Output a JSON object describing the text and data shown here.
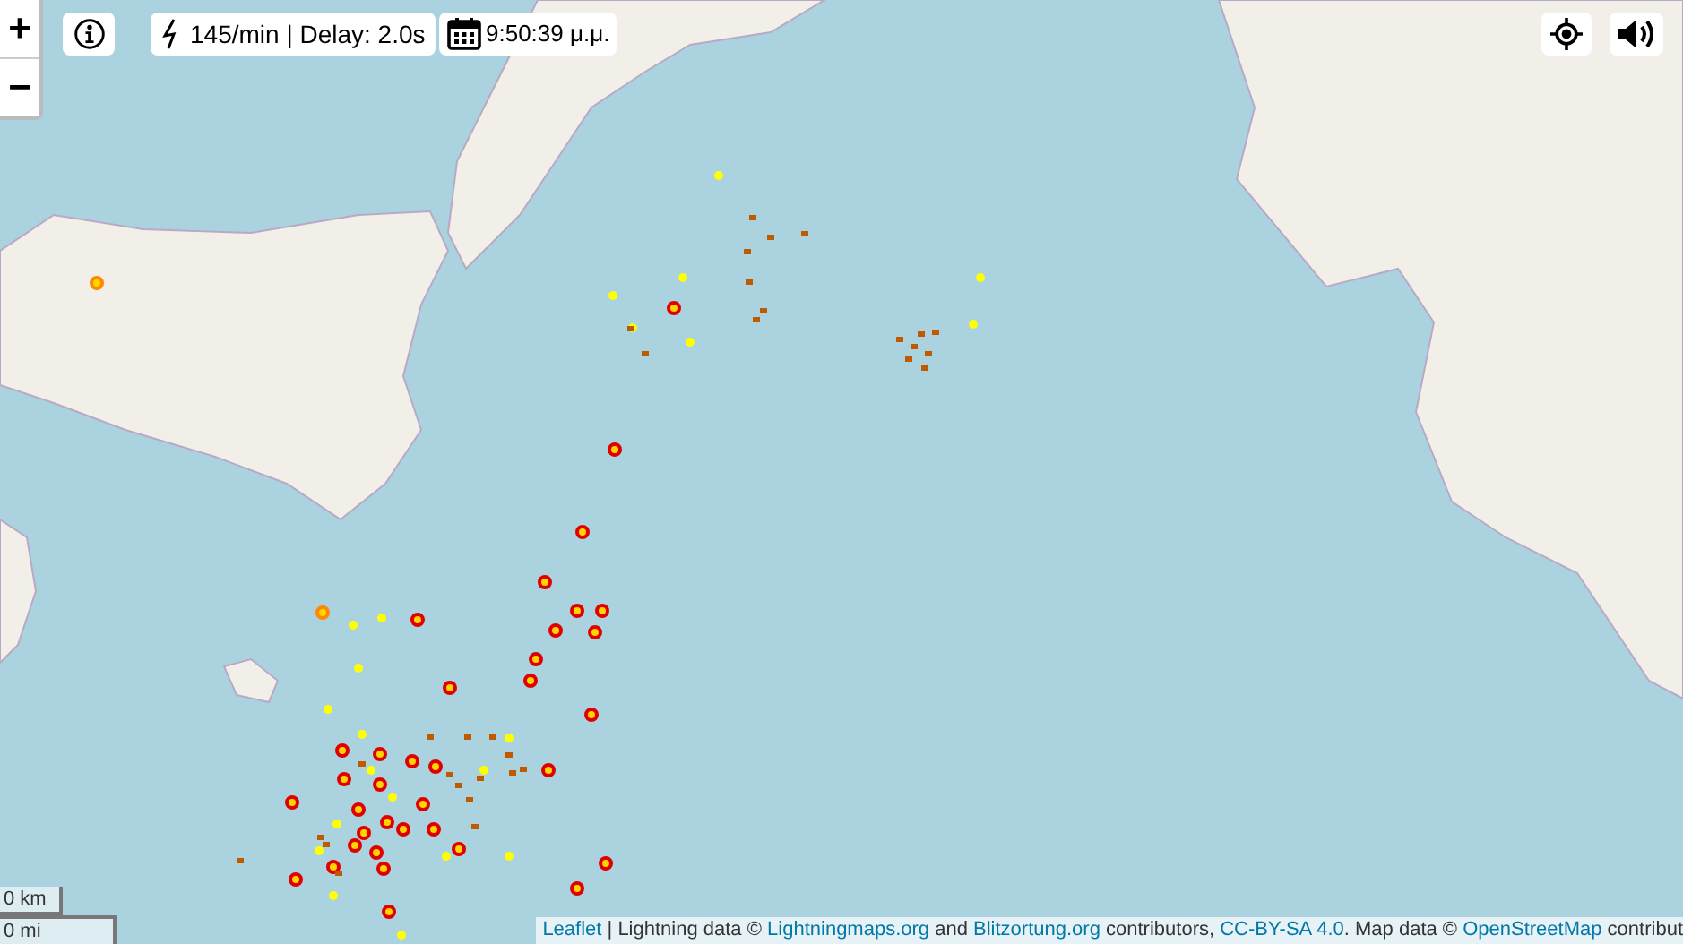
{
  "zoom_controls": {
    "zoom_in": "+",
    "zoom_out": "−"
  },
  "rate_box": {
    "text": "145/min | Delay: 2.0s"
  },
  "time_box": {
    "text": "9:50:39 μ.μ."
  },
  "scale": {
    "metric": "0 km",
    "imperial": "0 mi"
  },
  "attribution": [
    {
      "kind": "link",
      "text": "Leaflet"
    },
    {
      "kind": "text",
      "text": " | Lightning data © "
    },
    {
      "kind": "link",
      "text": "Lightningmaps.org"
    },
    {
      "kind": "text",
      "text": " and "
    },
    {
      "kind": "link",
      "text": "Blitzortung.org"
    },
    {
      "kind": "text",
      "text": " contributors, "
    },
    {
      "kind": "link",
      "text": "CC-BY-SA 4.0"
    },
    {
      "kind": "text",
      "text": ". Map data © "
    },
    {
      "kind": "link",
      "text": "OpenStreetMap"
    },
    {
      "kind": "text",
      "text": " contribut"
    }
  ]
}
